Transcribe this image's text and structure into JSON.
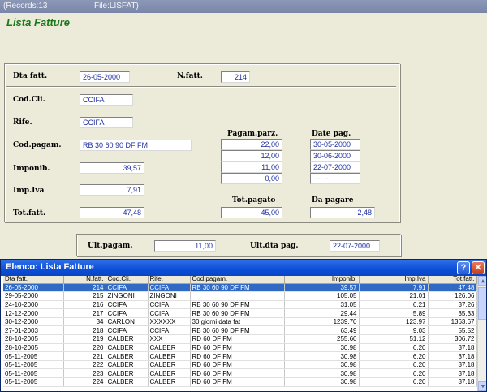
{
  "topbar": {
    "records": "(Records:13",
    "file": "File:LISFAT)"
  },
  "title": "Lista Fatture",
  "form": {
    "dta_fatt_label": "Dta fatt.",
    "dta_fatt": "26-05-2000",
    "n_fatt_label": "N.fatt.",
    "n_fatt": "214",
    "cod_cli_label": "Cod.Cli.",
    "cod_cli": "CCIFA",
    "rife_label": "Rife.",
    "rife": "CCIFA",
    "cod_pagam_label": "Cod.pagam.",
    "cod_pagam": "RB 30 60 90 DF FM",
    "imponib_label": "Imponib.",
    "imponib": "39,57",
    "imp_iva_label": "Imp.Iva",
    "imp_iva": "7,91",
    "tot_fatt_label": "Tot.fatt.",
    "tot_fatt": "47,48",
    "pagam_parz_label": "Pagam.parz.",
    "pagam_parz": [
      "22,00",
      "12,00",
      "11,00",
      "0,00"
    ],
    "date_pag_label": "Date pag.",
    "date_pag": [
      "30-05-2000",
      "30-06-2000",
      "22-07-2000",
      "  -   -  "
    ],
    "tot_pagato_label": "Tot.pagato",
    "tot_pagato": "45,00",
    "da_pagare_label": "Da pagare",
    "da_pagare": "2,48"
  },
  "footer": {
    "ult_pagam_label": "Ult.pagam.",
    "ult_pagam": "11,00",
    "ult_dta_pag_label": "Ult.dta pag.",
    "ult_dta_pag": "22-07-2000"
  },
  "list": {
    "title": "Elenco: Lista Fatture",
    "help": "?",
    "close": "✕",
    "columns": [
      "Dta fatt.",
      "N.fatt.",
      "Cod.Cli.",
      "Rife.",
      "Cod.pagam.",
      "Imponib.",
      "Imp.Iva",
      "Tot.fatt."
    ],
    "rows": [
      [
        "26-05-2000",
        "214",
        "CCIFA",
        "CCIFA",
        "RB 30 60 90 DF FM",
        "39.57",
        "7.91",
        "47.48"
      ],
      [
        "29-05-2000",
        "215",
        "ZINGONI",
        "ZINGONI",
        "",
        "105.05",
        "21.01",
        "126.06"
      ],
      [
        "24-10-2000",
        "216",
        "CCIFA",
        "CCIFA",
        "RB 30 60 90 DF FM",
        "31.05",
        "6.21",
        "37.26"
      ],
      [
        "12-12-2000",
        "217",
        "CCIFA",
        "CCIFA",
        "RB 30 60 90 DF FM",
        "29.44",
        "5.89",
        "35.33"
      ],
      [
        "30-12-2000",
        "34",
        "CARLON",
        "XXXXXX",
        "30 giorni data fat",
        "1239.70",
        "123.97",
        "1363.67"
      ],
      [
        "27-01-2003",
        "218",
        "CCIFA",
        "CCIFA",
        "RB 30 60 90 DF FM",
        "63.49",
        "9.03",
        "55.52"
      ],
      [
        "28-10-2005",
        "219",
        "CALBER",
        "XXX",
        "RD 60 DF FM",
        "255.60",
        "51.12",
        "306.72"
      ],
      [
        "28-10-2005",
        "220",
        "CALBER",
        "CALBER",
        "RD 60 DF FM",
        "30.98",
        "6.20",
        "37.18"
      ],
      [
        "05-11-2005",
        "221",
        "CALBER",
        "CALBER",
        "RD 60 DF FM",
        "30.98",
        "6.20",
        "37.18"
      ],
      [
        "05-11-2005",
        "222",
        "CALBER",
        "CALBER",
        "RD 60 DF FM",
        "30.98",
        "6.20",
        "37.18"
      ],
      [
        "05-11-2005",
        "223",
        "CALBER",
        "CALBER",
        "RD 60 DF FM",
        "30.98",
        "6.20",
        "37.18"
      ],
      [
        "05-11-2005",
        "224",
        "CALBER",
        "CALBER",
        "RD 60 DF FM",
        "30.98",
        "6.20",
        "37.18"
      ]
    ],
    "selected_index": 0
  },
  "colors": {
    "title_green": "#1a7a1a",
    "field_text": "#1f2fa0",
    "selection": "#316ac5"
  },
  "icons": {
    "scroll_up": "chevron-up-icon",
    "scroll_down": "chevron-down-icon"
  }
}
